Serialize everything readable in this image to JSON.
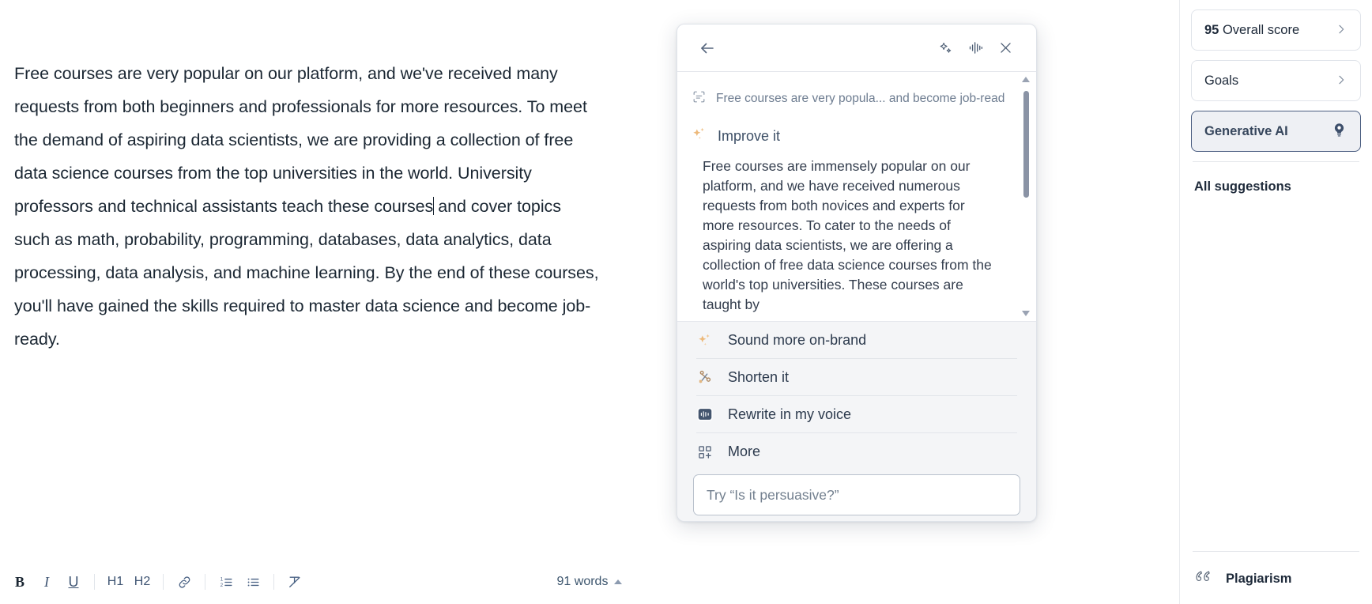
{
  "document": {
    "text_before_caret": "Free courses are very popular on our platform, and we've received many requests from both beginners and professionals for more resources. To meet the demand of aspiring data scientists, we are providing a collection of free data science courses from the top universities in the world. University professors and technical assistants teach these courses",
    "text_after_caret": " and cover topics such as math, probability, programming, databases, data analytics, data processing, data analysis, and machine learning. By the end of these courses, you'll have gained the skills required to master data science and become job-ready."
  },
  "toolbar": {
    "bold_label": "B",
    "italic_label": "I",
    "underline_label": "U",
    "h1_label": "H1",
    "h2_label": "H2",
    "link_icon": "link-icon",
    "numbered_list_icon": "numbered-list-icon",
    "bullet_list_icon": "bullet-list-icon",
    "clear_format_icon": "clear-formatting-icon",
    "word_count": "91 words"
  },
  "genai_panel": {
    "back_icon": "back-arrow-icon",
    "pin_icon": "sparkle-pin-icon",
    "voice_icon": "voice-waveform-icon",
    "close_icon": "close-icon",
    "source_icon": "text-selection-icon",
    "source_text": "Free courses are very popula... and become job-ready.",
    "improve_icon": "sparkles-icon",
    "improve_label": "Improve it",
    "suggestion_text": "Free courses are immensely popular on our platform, and we have received numerous requests from both novices and experts for more resources. To cater to the needs of aspiring data scientists, we are offering a collection of free data science courses from the world's top universities. These courses are taught by",
    "actions": [
      {
        "icon": "sparkles-icon",
        "label": "Sound more on-brand"
      },
      {
        "icon": "scissors-icon",
        "label": "Shorten it"
      },
      {
        "icon": "voice-waveform-icon",
        "label": "Rewrite in my voice"
      },
      {
        "icon": "grid-plus-icon",
        "label": "More"
      }
    ],
    "prompt_placeholder": "Try “Is it persuasive?”",
    "prompt_value": ""
  },
  "sidebar": {
    "cards": [
      {
        "score": "95",
        "label": " Overall score",
        "icon": "chevron-right-icon",
        "active": false
      },
      {
        "score": "",
        "label": "Goals",
        "icon": "chevron-right-icon",
        "active": false
      },
      {
        "score": "",
        "label": "Generative AI",
        "icon": "lightbulb-icon",
        "active": true
      }
    ],
    "all_suggestions_label": "All suggestions",
    "plagiarism_label": "Plagiarism",
    "plagiarism_icon": "quote-icon"
  },
  "colors": {
    "accent_gold": "#e8b36a",
    "panel_bg": "#f4f5f7",
    "text_dark": "#1b2733",
    "active_border": "#4a5d80"
  }
}
